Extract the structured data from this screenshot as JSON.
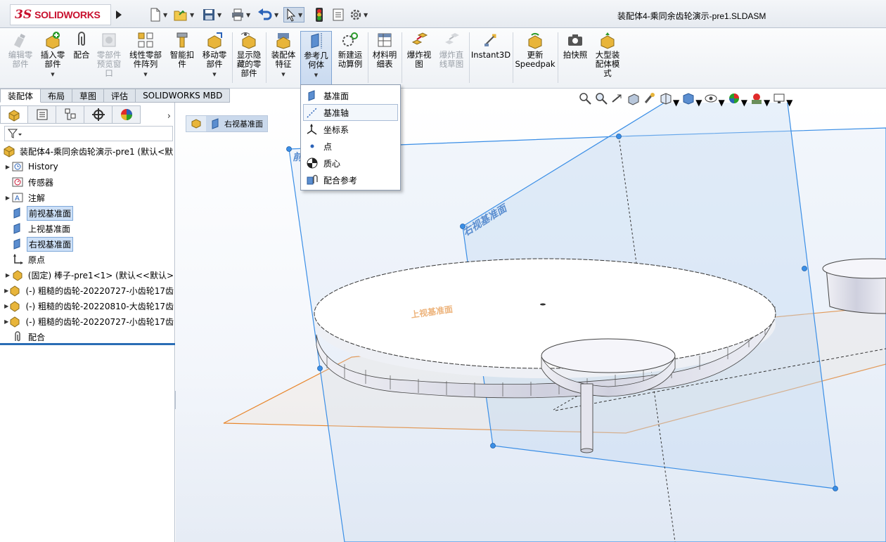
{
  "app": {
    "logo_ds": "3S",
    "logo_word": "SOLIDWORKS",
    "document_title": "装配体4-乘同余齿轮演示-pre1.SLDASM"
  },
  "ribbon": {
    "buttons": [
      {
        "label": "编辑零\n部件",
        "disabled": true
      },
      {
        "label": "插入零\n部件"
      },
      {
        "label": "配合"
      },
      {
        "label": "零部件\n预览窗\n口",
        "disabled": true
      },
      {
        "label": "线性零部\n件阵列"
      },
      {
        "label": "智能扣\n件"
      },
      {
        "label": "移动零\n部件"
      },
      {
        "label": "显示隐\n藏的零\n部件"
      },
      {
        "label": "装配体\n特征"
      },
      {
        "label": "参考几\n何体",
        "active": true
      },
      {
        "label": "新建运\n动算例"
      },
      {
        "label": "材料明\n细表"
      },
      {
        "label": "爆炸视\n图"
      },
      {
        "label": "爆炸直\n线草图",
        "disabled": true
      },
      {
        "label": "Instant3D"
      },
      {
        "label": "更新\nSpeedpak"
      },
      {
        "label": "拍快照"
      },
      {
        "label": "大型装\n配体模\n式"
      }
    ]
  },
  "command_tabs": [
    "装配体",
    "布局",
    "草图",
    "评估",
    "SOLIDWORKS MBD"
  ],
  "reference_geometry_menu": {
    "items": [
      "基准面",
      "基准轴",
      "坐标系",
      "点",
      "质心",
      "配合参考"
    ],
    "hovered": "基准轴"
  },
  "feature_tree": {
    "root": "装配体4-乘同余齿轮演示-pre1  (默认<默",
    "nodes": [
      {
        "label": "History",
        "expandable": true
      },
      {
        "label": "传感器"
      },
      {
        "label": "注解",
        "expandable": true
      },
      {
        "label": "前视基准面",
        "highlighted": true
      },
      {
        "label": "上视基准面"
      },
      {
        "label": "右视基准面",
        "highlighted": true
      },
      {
        "label": "原点"
      },
      {
        "label": "(固定) 棒子-pre1<1> (默认<<默认>",
        "expandable": true
      },
      {
        "label": "(-) 粗糙的齿轮-20220727-小齿轮17齿",
        "expandable": true
      },
      {
        "label": "(-) 粗糙的齿轮-20220810-大齿轮17齿",
        "expandable": true
      },
      {
        "label": "(-) 粗糙的齿轮-20220727-小齿轮17齿",
        "expandable": true
      },
      {
        "label": "配合"
      }
    ]
  },
  "viewport": {
    "breadcrumb_selection": "右视基准面",
    "plane_label_right": "右视基准面",
    "plane_label_top": "上视基准面",
    "plane_label_front": "前"
  }
}
